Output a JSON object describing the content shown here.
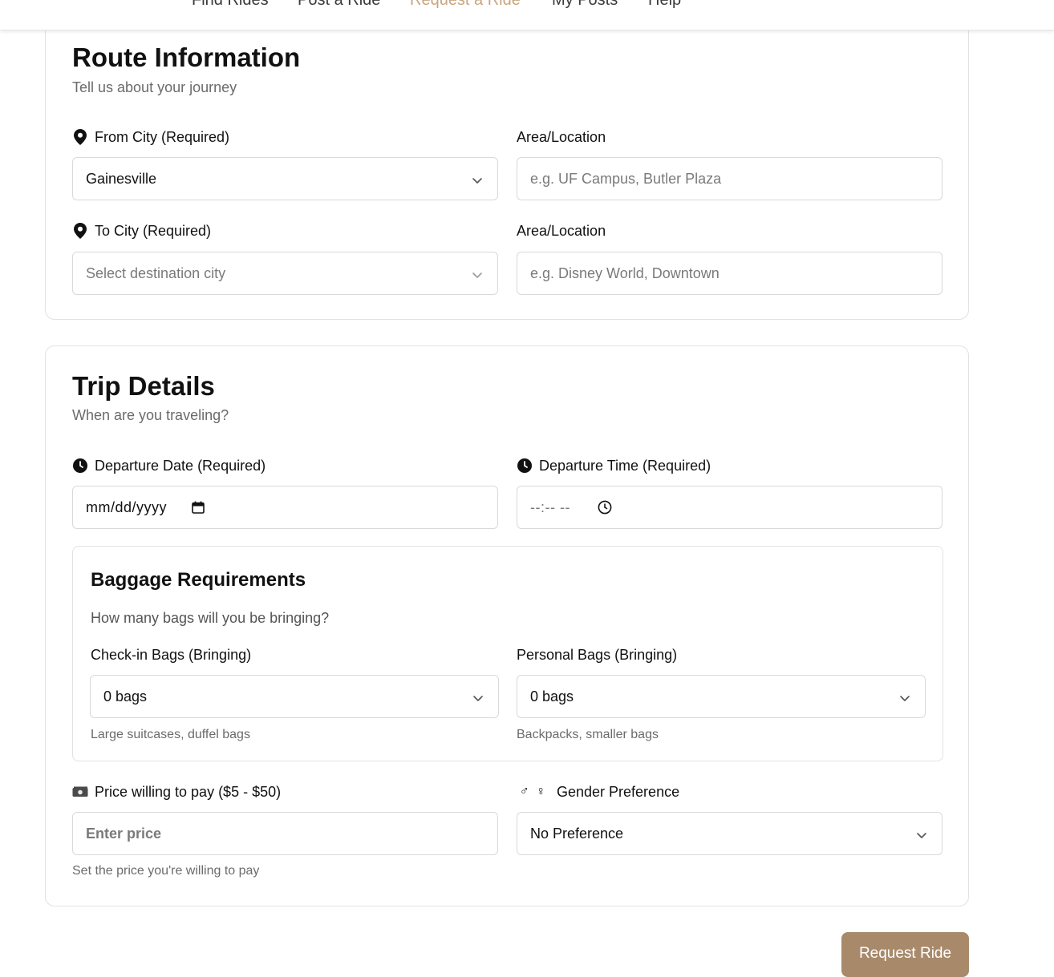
{
  "nav": {
    "items": [
      {
        "label": "Find Rides"
      },
      {
        "label": "Post a Ride"
      },
      {
        "label": "Request a Ride",
        "active": true
      },
      {
        "label": "My Posts"
      },
      {
        "label": "Help"
      }
    ],
    "active_color": "#c9a57f"
  },
  "route": {
    "title": "Route Information",
    "subtitle": "Tell us about your journey",
    "from_city": {
      "label": "From City (Required)",
      "value": "Gainesville",
      "icon": "map-pin-icon"
    },
    "from_area": {
      "label": "Area/Location",
      "placeholder": "e.g. UF Campus, Butler Plaza"
    },
    "to_city": {
      "label": "To City (Required)",
      "placeholder": "Select destination city",
      "icon": "map-pin-icon"
    },
    "to_area": {
      "label": "Area/Location",
      "placeholder": "e.g. Disney World, Downtown"
    }
  },
  "trip": {
    "title": "Trip Details",
    "subtitle": "When are you traveling?",
    "date": {
      "label": "Departure Date (Required)",
      "placeholder": "mm/dd/yyyy",
      "icon": "clock-icon"
    },
    "time": {
      "label": "Departure Time (Required)",
      "placeholder": "--:-- --",
      "icon": "clock-icon"
    },
    "baggage": {
      "title": "Baggage Requirements",
      "subtitle": "How many bags will you be bringing?",
      "checkin": {
        "label": "Check-in Bags (Bringing)",
        "value": "0 bags",
        "hint": "Large suitcases, duffel bags"
      },
      "personal": {
        "label": "Personal Bags (Bringing)",
        "value": "0 bags",
        "hint": "Backpacks, smaller bags"
      }
    },
    "price": {
      "label": "Price willing to pay ($5 - $50)",
      "placeholder": "Enter price",
      "hint": "Set the price you're willing to pay",
      "icon": "money-icon"
    },
    "gender": {
      "label": "Gender Preference",
      "value": "No Preference",
      "icon": "gender-icon",
      "icon_glyphs": "♂ ♀"
    }
  },
  "submit_label": "Request Ride",
  "colors": {
    "accent": "#a88a6b",
    "border": "#d9d9d9"
  }
}
